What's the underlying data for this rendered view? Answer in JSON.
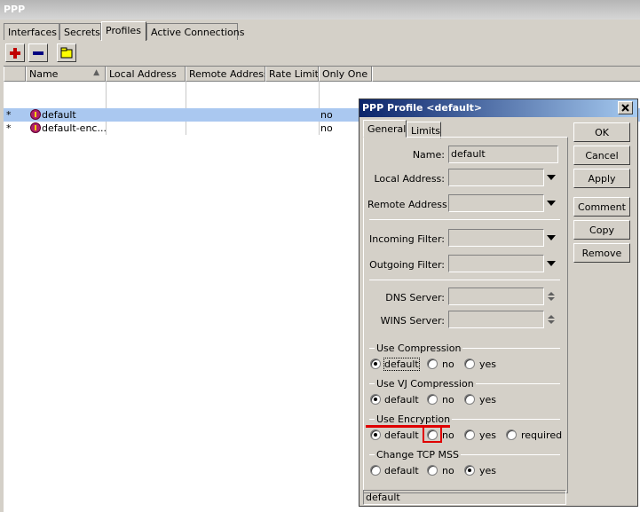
{
  "window": {
    "title": "PPP"
  },
  "tabs": [
    {
      "label": "Interfaces"
    },
    {
      "label": "Secrets"
    },
    {
      "label": "Profiles",
      "active": true
    },
    {
      "label": "Active Connections"
    }
  ],
  "toolbar": {
    "add": "add-icon",
    "remove": "remove-icon",
    "comment": "comment-icon"
  },
  "table": {
    "columns": [
      "Name",
      "Local Address",
      "Remote Address",
      "Rate Limit",
      "Only One"
    ],
    "rows": [
      {
        "flag": "*",
        "name": "default",
        "local": "",
        "remote": "",
        "rate": "",
        "only_one": "no",
        "selected": true
      },
      {
        "flag": "*",
        "name": "default-enc...",
        "local": "",
        "remote": "",
        "rate": "",
        "only_one": "no",
        "selected": false
      }
    ]
  },
  "dialog": {
    "title": "PPP Profile <default>",
    "tabs": [
      "General",
      "Limits"
    ],
    "fields": {
      "name_label": "Name:",
      "name_value": "default",
      "local_label": "Local Address:",
      "remote_label": "Remote Address:",
      "in_filter_label": "Incoming Filter:",
      "out_filter_label": "Outgoing Filter:",
      "dns_label": "DNS Server:",
      "wins_label": "WINS Server:"
    },
    "groups": {
      "compression": {
        "label": "Use Compression",
        "options": [
          "default",
          "no",
          "yes"
        ],
        "selected": "default"
      },
      "vj": {
        "label": "Use VJ Compression",
        "options": [
          "default",
          "no",
          "yes"
        ],
        "selected": "default"
      },
      "encryption": {
        "label": "Use Encryption",
        "options": [
          "default",
          "no",
          "yes",
          "required"
        ],
        "selected": "default"
      },
      "tcp_mss": {
        "label": "Change TCP MSS",
        "options": [
          "default",
          "no",
          "yes"
        ],
        "selected": "yes"
      }
    },
    "buttons": [
      "OK",
      "Cancel",
      "Apply",
      "Comment",
      "Copy",
      "Remove"
    ],
    "status": "default"
  },
  "colors": {
    "selection": "#aac8f0",
    "titlebar": "#0a246a",
    "highlight": "#e00000"
  }
}
